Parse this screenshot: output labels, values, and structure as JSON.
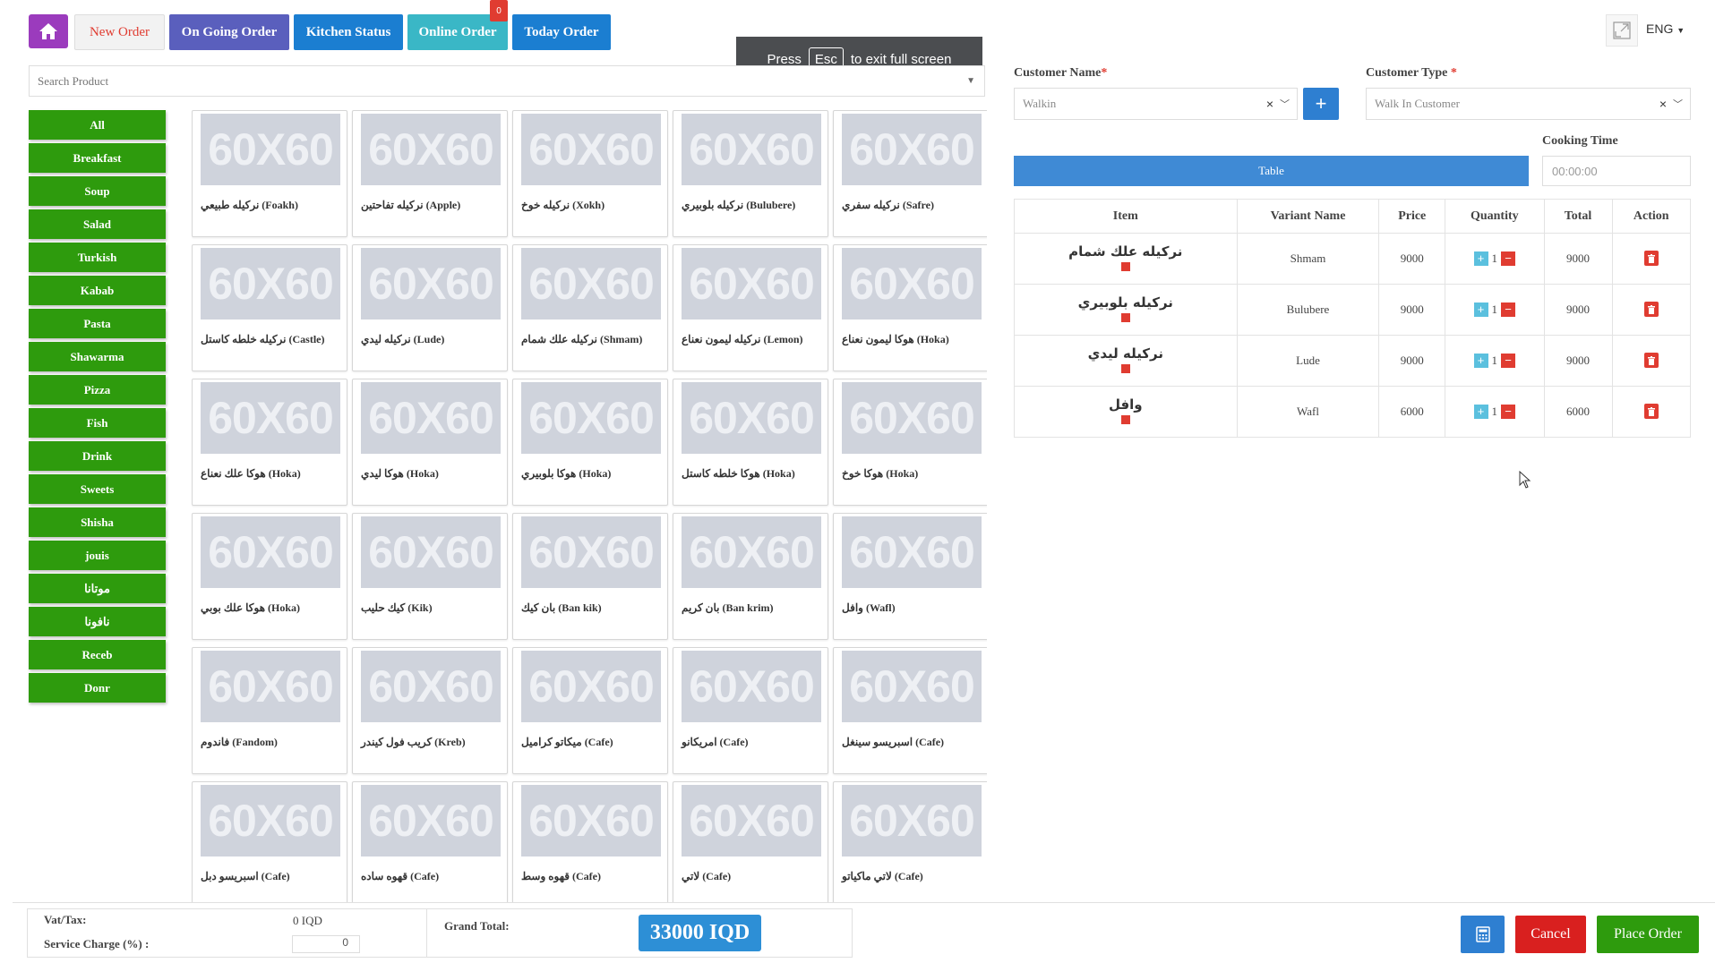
{
  "nav": {
    "new_order": "New Order",
    "ongoing_order": "On Going Order",
    "kitchen_status": "Kitchen Status",
    "online_order": "Online Order",
    "online_badge": "0",
    "today_order": "Today Order"
  },
  "fullscreen_toast": {
    "press": "Press",
    "key": "Esc",
    "message": "to exit full screen"
  },
  "language": "ENG",
  "search": {
    "placeholder": "Search Product"
  },
  "categories": [
    "All",
    "Breakfast",
    "Soup",
    "Salad",
    "Turkish",
    "Kabab",
    "Pasta",
    "Shawarma",
    "Pizza",
    "Fish",
    "Drink",
    "Sweets",
    "Shisha",
    "jouis",
    "موتانا",
    "نافونا",
    "Receb",
    "Donr"
  ],
  "product_image_text": "60X60",
  "products": [
    "نركيله طبيعي (Foakh)",
    "نركيله تفاحتين (Apple)",
    "نركيله خوخ (Xokh)",
    "نركيله بلوبيري (Bulubere)",
    "نركيله سفري (Safre)",
    "نركيله خلطه كاستل (Castle)",
    "نركيله ليدي (Lude)",
    "نركيله علك شمام (Shmam)",
    "نركيله ليمون نعناع (Lemon)",
    "هوكا ليمون نعناع (Hoka)",
    "هوكا علك نعناع (Hoka)",
    "هوكا ليدي (Hoka)",
    "هوكا بلوبيري (Hoka)",
    "هوكا خلطه كاستل (Hoka)",
    "هوكا خوخ (Hoka)",
    "هوكا علك بوبي (Hoka)",
    "كيك حليب (Kik)",
    "بان كيك (Ban kik)",
    "بان كريم (Ban krim)",
    "وافل (Wafl)",
    "فاندوم (Fandom)",
    "كريب فول كيندر (Kreb)",
    "ميكاتو كراميل (Cafe)",
    "امريكانو (Cafe)",
    "اسبريسو سينغل (Cafe)",
    "اسبريسو دبل (Cafe)",
    "قهوه ساده (Cafe)",
    "قهوه وسط (Cafe)",
    "لاتي (Cafe)",
    "لاتي ماكياتو (Cafe)"
  ],
  "customer": {
    "name_label": "Customer Name",
    "name_value": "Walkin",
    "type_label": "Customer Type",
    "type_value": "Walk In Customer",
    "required_mark": "*",
    "add_symbol": "+",
    "clear_symbol": "×"
  },
  "table_button": "Table",
  "cooking_time": {
    "label": "Cooking Time",
    "placeholder": "00:00:00"
  },
  "order_table": {
    "headers": [
      "Item",
      "Variant Name",
      "Price",
      "Quantity",
      "Total",
      "Action"
    ],
    "rows": [
      {
        "item": "نركيله علك شمام",
        "variant": "Shmam",
        "price": "9000",
        "qty": "1",
        "total": "9000"
      },
      {
        "item": "نركيله بلوبيري",
        "variant": "Bulubere",
        "price": "9000",
        "qty": "1",
        "total": "9000"
      },
      {
        "item": "نركيله ليدي",
        "variant": "Lude",
        "price": "9000",
        "qty": "1",
        "total": "9000"
      },
      {
        "item": "وافل",
        "variant": "Wafl",
        "price": "6000",
        "qty": "1",
        "total": "6000"
      }
    ]
  },
  "footer": {
    "vat_label": "Vat/Tax:",
    "vat_value": "0 IQD",
    "service_label": "Service Charge (%) :",
    "service_value": "0",
    "grand_total_label": "Grand Total:",
    "grand_total_value": "33000 IQD",
    "cancel": "Cancel",
    "place_order": "Place Order"
  },
  "colors": {
    "home": "#9b3bbd",
    "category": "#2e9b0d",
    "primary": "#2e7fd1",
    "danger": "#d9201f",
    "online": "#3ab7c6",
    "ongoing": "#5a5fbd"
  },
  "icons": {
    "home": "home-icon",
    "expand": "expand-icon",
    "calculator": "calculator-icon",
    "delete": "trash-icon"
  }
}
